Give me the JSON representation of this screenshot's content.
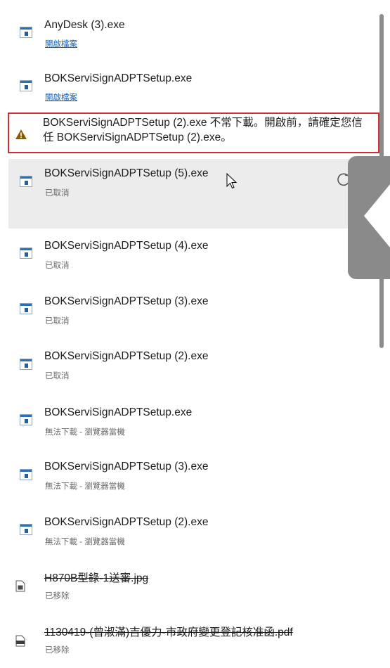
{
  "downloads": {
    "items": [
      {
        "name": "AnyDesk (3).exe",
        "status": "開啟檔案",
        "status_type": "link",
        "icon": "exe-file-icon"
      },
      {
        "name": "BOKServiSignADPTSetup.exe",
        "status": "開啟檔案",
        "status_type": "link",
        "icon": "exe-file-icon"
      },
      {
        "name": "BOKServiSignADPTSetup (2).exe 不常下載。開啟前，請確定您信任 BOKServiSignADPTSetup (2).exe。",
        "status_type": "warning",
        "icon": "warning-icon"
      },
      {
        "name": "BOKServiSignADPTSetup (5).exe",
        "status": "已取消",
        "status_type": "canceled",
        "icon": "exe-file-icon",
        "hovered": true,
        "action_icon": "retry-icon"
      },
      {
        "name": "BOKServiSignADPTSetup (4).exe",
        "status": "已取消",
        "status_type": "canceled",
        "icon": "exe-file-icon"
      },
      {
        "name": "BOKServiSignADPTSetup (3).exe",
        "status": "已取消",
        "status_type": "canceled",
        "icon": "exe-file-icon"
      },
      {
        "name": "BOKServiSignADPTSetup (2).exe",
        "status": "已取消",
        "status_type": "canceled",
        "icon": "exe-file-icon"
      },
      {
        "name": "BOKServiSignADPTSetup.exe",
        "status": "無法下載 - 瀏覽器當機",
        "status_type": "failed",
        "icon": "exe-file-icon"
      },
      {
        "name": "BOKServiSignADPTSetup (3).exe",
        "status": "無法下載 - 瀏覽器當機",
        "status_type": "failed",
        "icon": "exe-file-icon"
      },
      {
        "name": "BOKServiSignADPTSetup (2).exe",
        "status": "無法下載 - 瀏覽器當機",
        "status_type": "failed",
        "icon": "exe-file-icon"
      },
      {
        "name": "H870B型錄-1送審.jpg",
        "status": "已移除",
        "status_type": "removed",
        "icon": "image-file-icon"
      },
      {
        "name": "1130419-(曾淑滿)吉優力-市政府變更登記核准函.pdf",
        "status": "已移除",
        "status_type": "removed",
        "icon": "pdf-file-icon"
      }
    ]
  },
  "colors": {
    "link": "#1260b8",
    "warning_border": "#d22c37",
    "hover_row": "#ececec",
    "side_tab": "#8a8a8a"
  }
}
